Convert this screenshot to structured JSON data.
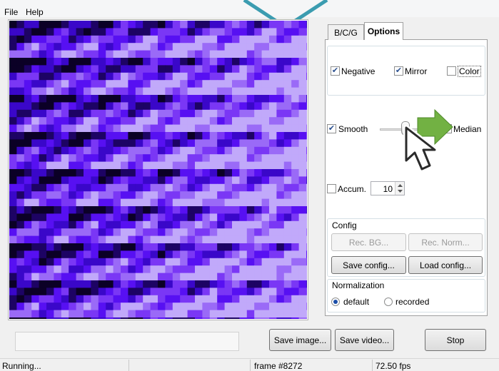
{
  "menu": {
    "file": "File",
    "help": "Help"
  },
  "video": {
    "colors": [
      "#0b0026",
      "#1d0364",
      "#3a07c9",
      "#5710f2",
      "#7a37f5",
      "#9a6af7",
      "#c1a9fa"
    ]
  },
  "tabs": {
    "bcg": "B/C/G",
    "options": "Options"
  },
  "options": {
    "negative_label": "Negative",
    "mirror_label": "Mirror",
    "color_label": "Color",
    "smooth_label": "Smooth",
    "median_label": "Median",
    "accum_label": "Accum.",
    "accum_value": "10"
  },
  "config": {
    "title": "Config",
    "rec_bg": "Rec. BG...",
    "rec_norm": "Rec. Norm...",
    "save": "Save config...",
    "load": "Load config..."
  },
  "normalization": {
    "title": "Normalization",
    "default_label": "default",
    "recorded_label": "recorded"
  },
  "buttons": {
    "save_image": "Save image...",
    "save_video": "Save video...",
    "stop": "Stop"
  },
  "status": {
    "state": "Running...",
    "frame": "frame #8272",
    "fps": "72.50 fps"
  },
  "accent_colors": {
    "arrow_green": "#72b143",
    "triangle_teal": "#3b9cb0"
  }
}
